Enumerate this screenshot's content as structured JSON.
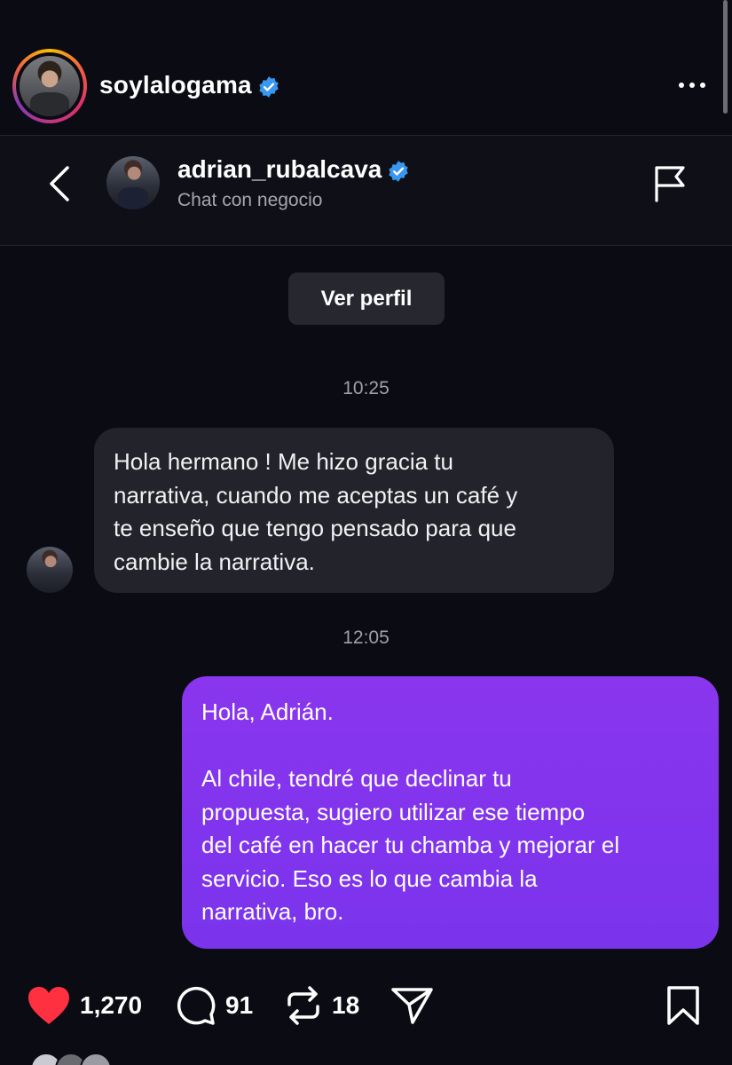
{
  "post": {
    "username": "soylalogama",
    "verified": true,
    "more_icon": "more-horizontal-icon"
  },
  "dm": {
    "contact_name": "adrian_rubalcava",
    "contact_verified": true,
    "subtitle": "Chat con negocio",
    "view_profile_label": "Ver perfil",
    "icons": {
      "back": "chevron-left-icon",
      "report": "flag-icon"
    }
  },
  "messages": [
    {
      "time": "10:25",
      "direction": "incoming",
      "lines": [
        "Hola hermano ! Me hizo gracia tu",
        "narrativa, cuando me aceptas un café y",
        "te enseño que tengo pensado para que",
        "cambie la narrativa."
      ]
    },
    {
      "time": "12:05",
      "direction": "outgoing",
      "paragraph1": "Hola, Adrián.",
      "lines2": [
        "Al chile, tendré que declinar tu",
        "propuesta, sugiero utilizar ese tiempo",
        "del café en hacer tu chamba y mejorar el",
        "servicio. Eso es lo que cambia la",
        "narrativa, bro."
      ]
    }
  ],
  "engagement": {
    "likes": "1,270",
    "comments": "91",
    "reposts": "18"
  },
  "colors": {
    "background": "#0b0c13",
    "incoming_bubble": "#23242b",
    "outgoing_bubble": "#8a35ee",
    "verified_badge": "#3897f0",
    "like_red": "#ff3040"
  }
}
